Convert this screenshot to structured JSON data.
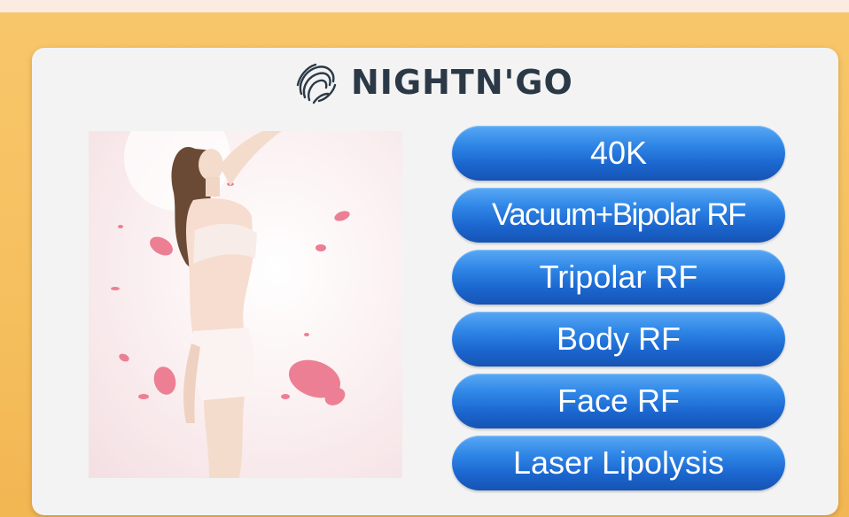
{
  "brand": {
    "name": "NIGHTN'GO",
    "logo_icon": "swirl-face-logo-icon"
  },
  "photo": {
    "subject": "model-with-rose-petals-image"
  },
  "menu": {
    "items": [
      {
        "label": "40K"
      },
      {
        "label": "Vacuum+Bipolar RF"
      },
      {
        "label": "Tripolar RF"
      },
      {
        "label": "Body RF"
      },
      {
        "label": "Face RF"
      },
      {
        "label": "Laser Lipolysis"
      }
    ]
  },
  "colors": {
    "frame": "#f5bf5e",
    "panel": "#f3f3f3",
    "button": "#2f86e6",
    "button_text": "#ffffff",
    "brand_text": "#2b3947"
  }
}
